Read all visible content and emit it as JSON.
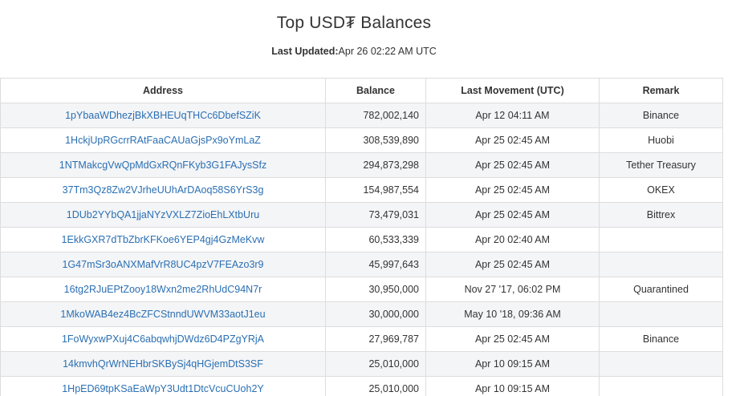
{
  "page": {
    "title": "Top USD₮ Balances",
    "updated_label": "Last Updated:",
    "updated_value": "Apr 26 02:22 AM UTC"
  },
  "table": {
    "headers": {
      "address": "Address",
      "balance": "Balance",
      "last_movement": "Last Movement (UTC)",
      "remark": "Remark"
    },
    "rows": [
      {
        "address": "1pYbaaWDhezjBkXBHEUqTHCc6DbefSZiK",
        "balance": "782,002,140",
        "last_movement": "Apr 12 04:11 AM",
        "remark": "Binance"
      },
      {
        "address": "1HckjUpRGcrrRAtFaaCAUaGjsPx9oYmLaZ",
        "balance": "308,539,890",
        "last_movement": "Apr 25 02:45 AM",
        "remark": "Huobi"
      },
      {
        "address": "1NTMakcgVwQpMdGxRQnFKyb3G1FAJysSfz",
        "balance": "294,873,298",
        "last_movement": "Apr 25 02:45 AM",
        "remark": "Tether Treasury"
      },
      {
        "address": "37Tm3Qz8Zw2VJrheUUhArDAoq58S6YrS3g",
        "balance": "154,987,554",
        "last_movement": "Apr 25 02:45 AM",
        "remark": "OKEX"
      },
      {
        "address": "1DUb2YYbQA1jjaNYzVXLZ7ZioEhLXtbUru",
        "balance": "73,479,031",
        "last_movement": "Apr 25 02:45 AM",
        "remark": "Bittrex"
      },
      {
        "address": "1EkkGXR7dTbZbrKFKoe6YEP4gj4GzMeKvw",
        "balance": "60,533,339",
        "last_movement": "Apr 20 02:40 AM",
        "remark": ""
      },
      {
        "address": "1G47mSr3oANXMafVrR8UC4pzV7FEAzo3r9",
        "balance": "45,997,643",
        "last_movement": "Apr 25 02:45 AM",
        "remark": ""
      },
      {
        "address": "16tg2RJuEPtZooy18Wxn2me2RhUdC94N7r",
        "balance": "30,950,000",
        "last_movement": "Nov 27 '17, 06:02 PM",
        "remark": "Quarantined"
      },
      {
        "address": "1MkoWAB4ez4BcZFCStnndUWVM33aotJ1eu",
        "balance": "30,000,000",
        "last_movement": "May 10 '18, 09:36 AM",
        "remark": ""
      },
      {
        "address": "1FoWyxwPXuj4C6abqwhjDWdz6D4PZgYRjA",
        "balance": "27,969,787",
        "last_movement": "Apr 25 02:45 AM",
        "remark": "Binance"
      },
      {
        "address": "14kmvhQrWrNEHbrSKBySj4qHGjemDtS3SF",
        "balance": "25,010,000",
        "last_movement": "Apr 10 09:15 AM",
        "remark": ""
      },
      {
        "address": "1HpED69tpKSaEaWpY3Udt1DtcVcuCUoh2Y",
        "balance": "25,010,000",
        "last_movement": "Apr 10 09:15 AM",
        "remark": ""
      }
    ]
  },
  "colors": {
    "link": "#2a6fb3",
    "text": "#333333",
    "stripe": "#f4f5f7",
    "border": "#dddddd"
  }
}
